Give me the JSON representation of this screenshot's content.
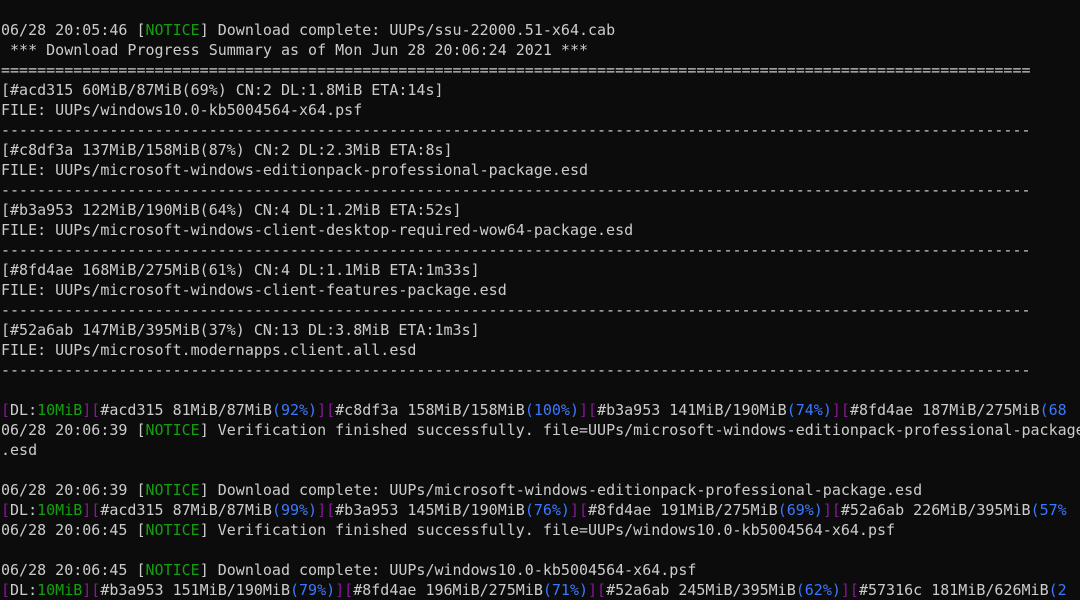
{
  "terminal": {
    "colors": {
      "background": "#0c0c0c",
      "text": "#cccccc",
      "notice": "#13a10e",
      "bracket": "#881798",
      "percent": "#3b78ff"
    },
    "lines": [
      [
        {
          "t": "06/28 20:05:46 [",
          "c": "default"
        },
        {
          "t": "NOTICE",
          "c": "green"
        },
        {
          "t": "] Download complete: UUPs/ssu-22000.51-x64.cab",
          "c": "default"
        }
      ],
      [
        {
          "t": " *** Download Progress Summary as of Mon Jun 28 20:06:24 2021 ***",
          "c": "default"
        }
      ],
      [
        {
          "t": "==================================================================================================================",
          "c": "default"
        }
      ],
      [
        {
          "t": "[#acd315 60MiB/87MiB(69%) CN:2 DL:1.8MiB ETA:14s]",
          "c": "default"
        }
      ],
      [
        {
          "t": "FILE: UUPs/windows10.0-kb5004564-x64.psf",
          "c": "default"
        }
      ],
      [
        {
          "t": "------------------------------------------------------------------------------------------------------------------",
          "c": "default"
        }
      ],
      [
        {
          "t": "[#c8df3a 137MiB/158MiB(87%) CN:2 DL:2.3MiB ETA:8s]",
          "c": "default"
        }
      ],
      [
        {
          "t": "FILE: UUPs/microsoft-windows-editionpack-professional-package.esd",
          "c": "default"
        }
      ],
      [
        {
          "t": "------------------------------------------------------------------------------------------------------------------",
          "c": "default"
        }
      ],
      [
        {
          "t": "[#b3a953 122MiB/190MiB(64%) CN:4 DL:1.2MiB ETA:52s]",
          "c": "default"
        }
      ],
      [
        {
          "t": "FILE: UUPs/microsoft-windows-client-desktop-required-wow64-package.esd",
          "c": "default"
        }
      ],
      [
        {
          "t": "------------------------------------------------------------------------------------------------------------------",
          "c": "default"
        }
      ],
      [
        {
          "t": "[#8fd4ae 168MiB/275MiB(61%) CN:4 DL:1.1MiB ETA:1m33s]",
          "c": "default"
        }
      ],
      [
        {
          "t": "FILE: UUPs/microsoft-windows-client-features-package.esd",
          "c": "default"
        }
      ],
      [
        {
          "t": "------------------------------------------------------------------------------------------------------------------",
          "c": "default"
        }
      ],
      [
        {
          "t": "[#52a6ab 147MiB/395MiB(37%) CN:13 DL:3.8MiB ETA:1m3s]",
          "c": "default"
        }
      ],
      [
        {
          "t": "FILE: UUPs/microsoft.modernapps.client.all.esd",
          "c": "default"
        }
      ],
      [
        {
          "t": "------------------------------------------------------------------------------------------------------------------",
          "c": "default"
        }
      ],
      [],
      [
        {
          "t": "[",
          "c": "magenta"
        },
        {
          "t": "DL:",
          "c": "default"
        },
        {
          "t": "10MiB",
          "c": "green"
        },
        {
          "t": "][",
          "c": "magenta"
        },
        {
          "t": "#acd315 81MiB/87MiB",
          "c": "default"
        },
        {
          "t": "(92%)",
          "c": "blue"
        },
        {
          "t": "][",
          "c": "magenta"
        },
        {
          "t": "#c8df3a 158MiB/158MiB",
          "c": "default"
        },
        {
          "t": "(100%)",
          "c": "blue"
        },
        {
          "t": "][",
          "c": "magenta"
        },
        {
          "t": "#b3a953 141MiB/190MiB",
          "c": "default"
        },
        {
          "t": "(74%)",
          "c": "blue"
        },
        {
          "t": "][",
          "c": "magenta"
        },
        {
          "t": "#8fd4ae 187MiB/275MiB",
          "c": "default"
        },
        {
          "t": "(68",
          "c": "blue"
        }
      ],
      [
        {
          "t": "06/28 20:06:39 [",
          "c": "default"
        },
        {
          "t": "NOTICE",
          "c": "green"
        },
        {
          "t": "] Verification finished successfully. file=UUPs/microsoft-windows-editionpack-professional-package",
          "c": "default"
        }
      ],
      [
        {
          "t": ".esd",
          "c": "default"
        }
      ],
      [],
      [
        {
          "t": "06/28 20:06:39 [",
          "c": "default"
        },
        {
          "t": "NOTICE",
          "c": "green"
        },
        {
          "t": "] Download complete: UUPs/microsoft-windows-editionpack-professional-package.esd",
          "c": "default"
        }
      ],
      [
        {
          "t": "[",
          "c": "magenta"
        },
        {
          "t": "DL:",
          "c": "default"
        },
        {
          "t": "10MiB",
          "c": "green"
        },
        {
          "t": "][",
          "c": "magenta"
        },
        {
          "t": "#acd315 87MiB/87MiB",
          "c": "default"
        },
        {
          "t": "(99%)",
          "c": "blue"
        },
        {
          "t": "][",
          "c": "magenta"
        },
        {
          "t": "#b3a953 145MiB/190MiB",
          "c": "default"
        },
        {
          "t": "(76%)",
          "c": "blue"
        },
        {
          "t": "][",
          "c": "magenta"
        },
        {
          "t": "#8fd4ae 191MiB/275MiB",
          "c": "default"
        },
        {
          "t": "(69%)",
          "c": "blue"
        },
        {
          "t": "][",
          "c": "magenta"
        },
        {
          "t": "#52a6ab 226MiB/395MiB",
          "c": "default"
        },
        {
          "t": "(57%",
          "c": "blue"
        }
      ],
      [
        {
          "t": "06/28 20:06:45 [",
          "c": "default"
        },
        {
          "t": "NOTICE",
          "c": "green"
        },
        {
          "t": "] Verification finished successfully. file=UUPs/windows10.0-kb5004564-x64.psf",
          "c": "default"
        }
      ],
      [],
      [
        {
          "t": "06/28 20:06:45 [",
          "c": "default"
        },
        {
          "t": "NOTICE",
          "c": "green"
        },
        {
          "t": "] Download complete: UUPs/windows10.0-kb5004564-x64.psf",
          "c": "default"
        }
      ],
      [
        {
          "t": "[",
          "c": "magenta"
        },
        {
          "t": "DL:",
          "c": "default"
        },
        {
          "t": "10MiB",
          "c": "green"
        },
        {
          "t": "][",
          "c": "magenta"
        },
        {
          "t": "#b3a953 151MiB/190MiB",
          "c": "default"
        },
        {
          "t": "(79%)",
          "c": "blue"
        },
        {
          "t": "][",
          "c": "magenta"
        },
        {
          "t": "#8fd4ae 196MiB/275MiB",
          "c": "default"
        },
        {
          "t": "(71%)",
          "c": "blue"
        },
        {
          "t": "][",
          "c": "magenta"
        },
        {
          "t": "#52a6ab 245MiB/395MiB",
          "c": "default"
        },
        {
          "t": "(62%)",
          "c": "blue"
        },
        {
          "t": "][",
          "c": "magenta"
        },
        {
          "t": "#57316c 181MiB/626MiB",
          "c": "default"
        },
        {
          "t": "(2",
          "c": "blue"
        }
      ]
    ]
  }
}
